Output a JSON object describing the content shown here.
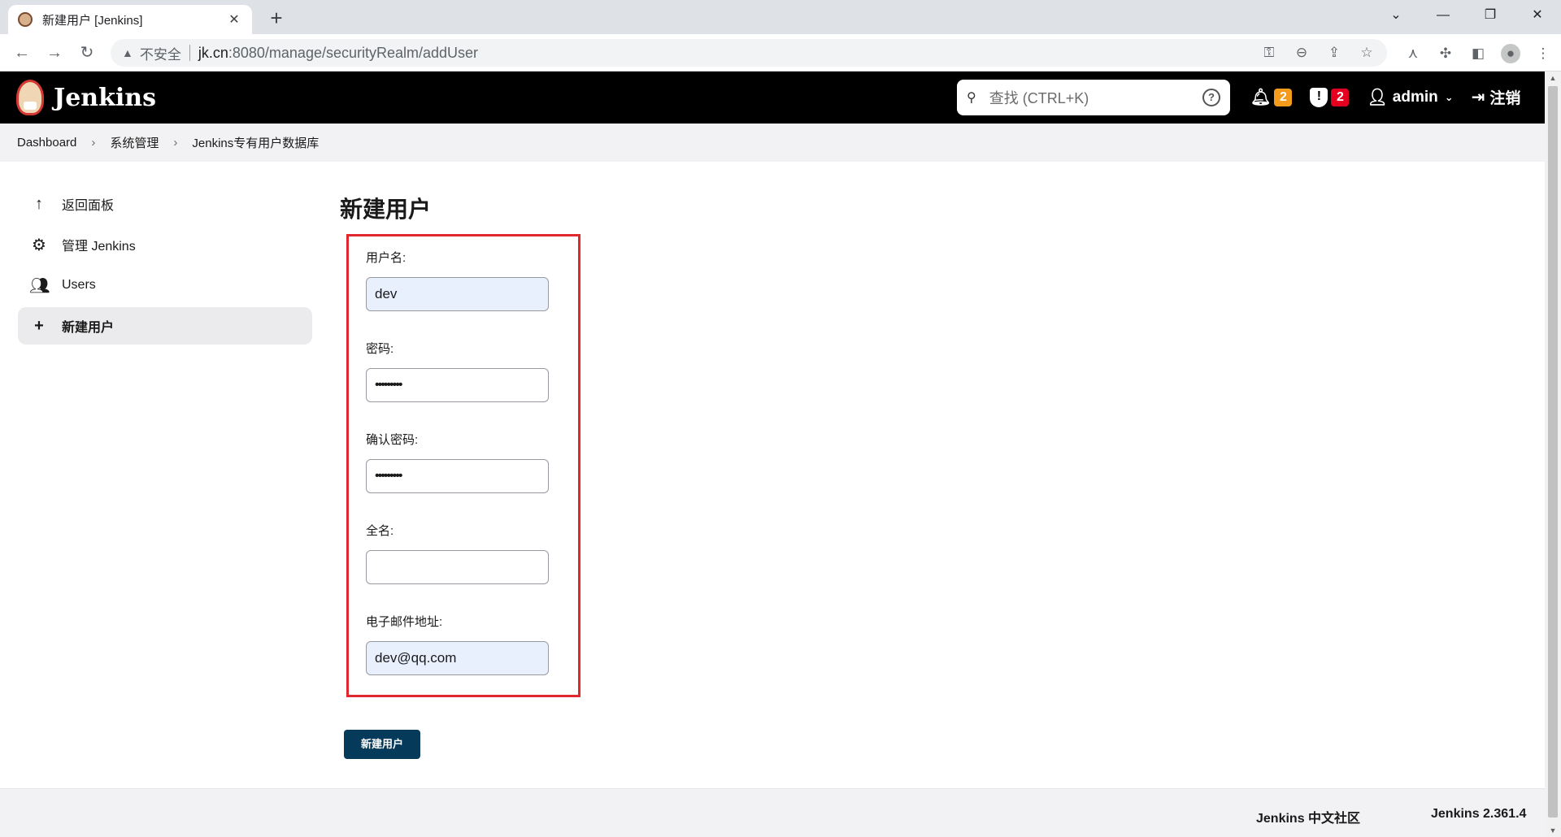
{
  "browser": {
    "tab_title": "新建用户 [Jenkins]",
    "tab_close": "✕",
    "new_tab": "+",
    "window_controls": [
      "⌄",
      "—",
      "❐",
      "✕"
    ],
    "back": "←",
    "forward": "→",
    "reload": "↻",
    "warning_glyph": "▲",
    "insecure_label": "不安全",
    "url_host": "jk.cn",
    "url_rest": ":8080/manage/securityRealm/addUser"
  },
  "header": {
    "brand": "Jenkins",
    "search_placeholder": "查找 (CTRL+K)",
    "help": "?",
    "notifications_count": "2",
    "security_count": "2",
    "user": "admin",
    "logout": "注销"
  },
  "breadcrumb": [
    "Dashboard",
    "系统管理",
    "Jenkins专有用户数据库"
  ],
  "sidebar": {
    "items": [
      {
        "icon": "arrow-up-icon",
        "label": "返回面板"
      },
      {
        "icon": "gear-icon",
        "label": "管理 Jenkins"
      },
      {
        "icon": "users-icon",
        "label": "Users"
      },
      {
        "icon": "plus-icon",
        "label": "新建用户"
      }
    ]
  },
  "form": {
    "title": "新建用户",
    "username_label": "用户名:",
    "username_value": "dev",
    "password_label": "密码:",
    "password_value": "•••••••••",
    "confirm_label": "确认密码:",
    "confirm_value": "•••••••••",
    "fullname_label": "全名:",
    "fullname_value": "",
    "email_label": "电子邮件地址:",
    "email_value": "dev@qq.com",
    "submit": "新建用户"
  },
  "footer": {
    "community": "Jenkins 中文社区",
    "version": "Jenkins 2.361.4"
  },
  "colors": {
    "header_bg": "#000000",
    "highlight_border": "#e0282e",
    "submit_bg": "#063a5a",
    "notification_badge": "#f29b1d",
    "security_badge": "#e6001f"
  }
}
